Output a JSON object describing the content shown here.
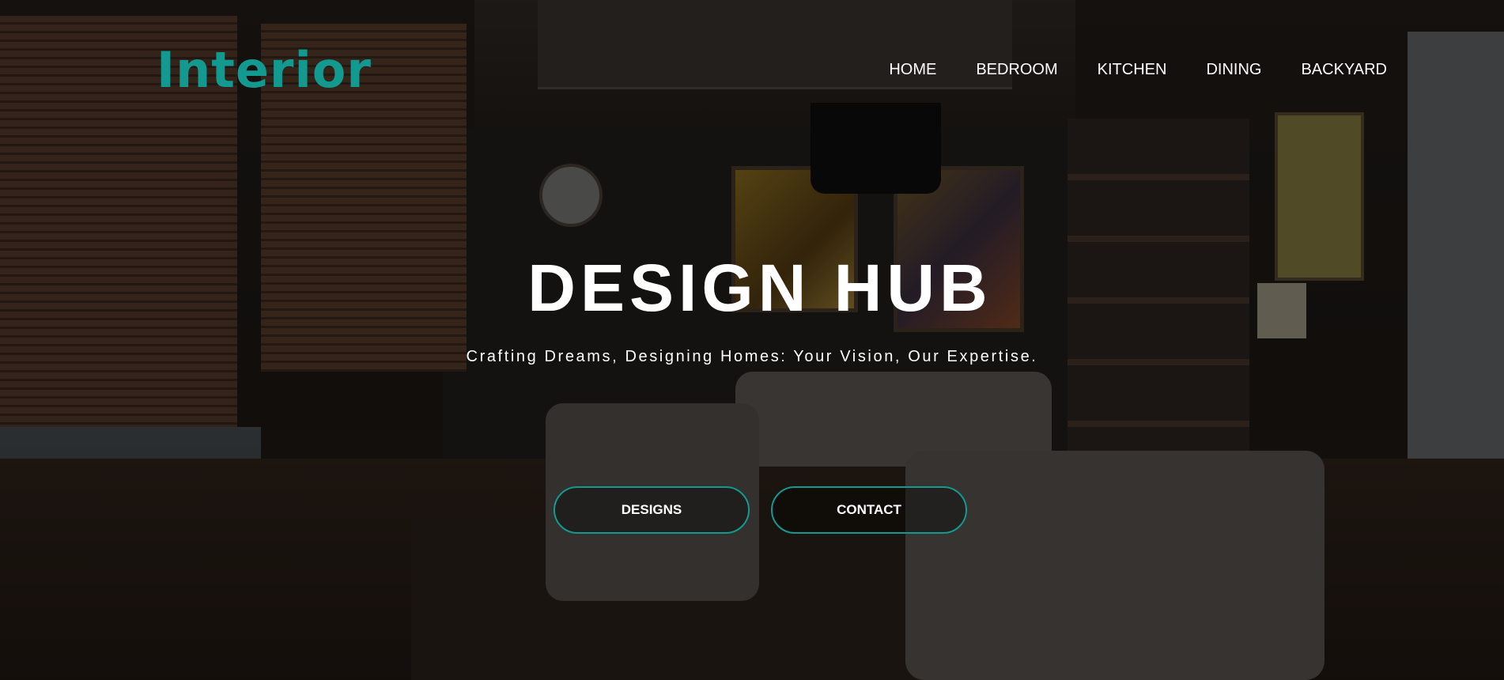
{
  "brand": {
    "logo_text": "Interior",
    "accent_color": "#129a91"
  },
  "nav": {
    "items": [
      {
        "label": "HOME"
      },
      {
        "label": "BEDROOM"
      },
      {
        "label": "KITCHEN"
      },
      {
        "label": "DINING"
      },
      {
        "label": "BACKYARD"
      }
    ]
  },
  "hero": {
    "title": "DESIGN HUB",
    "tagline": "Crafting Dreams, Designing Homes: Your Vision, Our Expertise.",
    "buttons": {
      "designs_label": "DESIGNS",
      "contact_label": "CONTACT"
    },
    "background": "dark-living-room-photo"
  }
}
